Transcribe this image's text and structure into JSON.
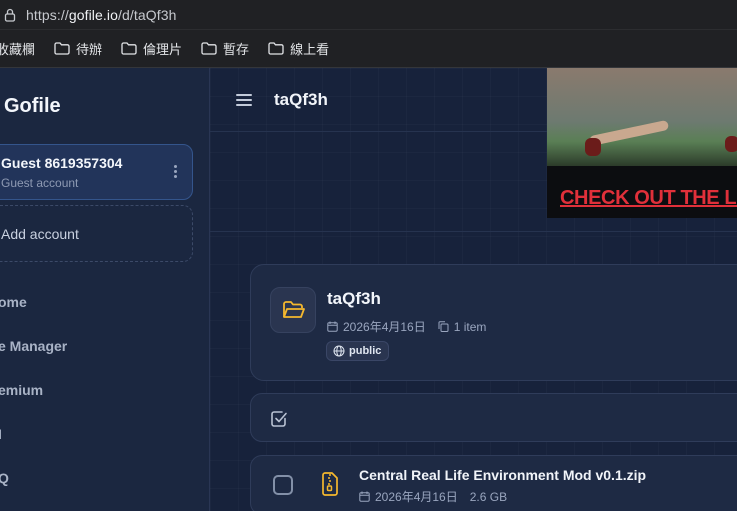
{
  "browser": {
    "url_prefix": "https://",
    "url_host": "gofile.io",
    "url_path": "/d/taQf3h",
    "bookmarks": [
      {
        "label": "收藏欄"
      },
      {
        "label": "待辦"
      },
      {
        "label": "倫理片"
      },
      {
        "label": "暫存"
      },
      {
        "label": "線上看"
      }
    ]
  },
  "sidebar": {
    "brand": "Gofile",
    "account": {
      "name": "Guest 8619357304",
      "type": "Guest account"
    },
    "add_account": "Add account",
    "nav": [
      {
        "label": "ome"
      },
      {
        "label": "e Manager"
      },
      {
        "label": "emium"
      },
      {
        "label": "I"
      },
      {
        "label": "Q"
      }
    ]
  },
  "header": {
    "title": "taQf3h"
  },
  "ad": {
    "text": "CHECK OUT THE LAT"
  },
  "folder": {
    "name": "taQf3h",
    "date": "2026年4月16日",
    "item_count": "1 item",
    "visibility": "public"
  },
  "files": [
    {
      "name": "Central Real Life Environment Mod v0.1.zip",
      "date": "2026年4月16日",
      "size": "2.6 GB"
    }
  ],
  "colors": {
    "accent": "#f5b82e",
    "ad_text": "#e0303a"
  }
}
